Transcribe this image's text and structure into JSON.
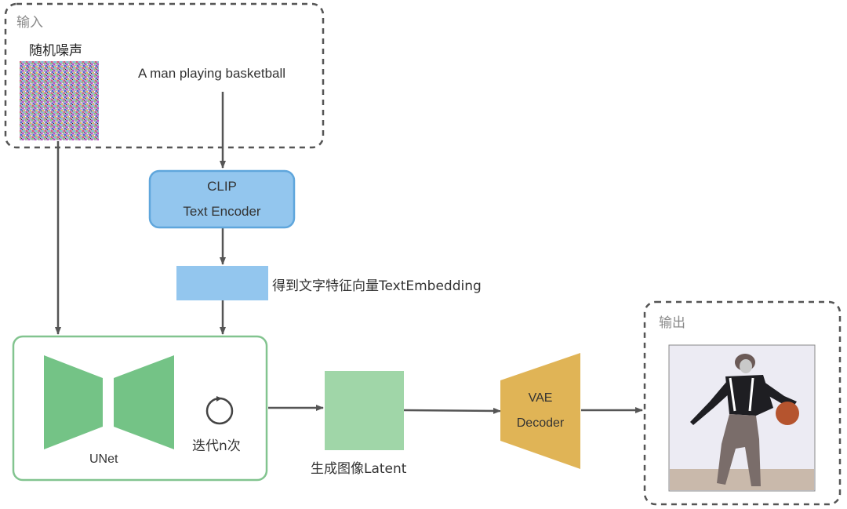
{
  "diagram": {
    "input_group": {
      "label": "输入"
    },
    "noise": {
      "label": "随机噪声"
    },
    "prompt": {
      "text": "A man playing basketball"
    },
    "clip": {
      "line1": "CLIP",
      "line2": "Text Encoder"
    },
    "embedding": {
      "label": "得到文字特征向量TextEmbedding"
    },
    "unet": {
      "label": "UNet",
      "iterate_label": "迭代n次"
    },
    "latent": {
      "label": "生成图像Latent"
    },
    "vae": {
      "line1": "VAE",
      "line2": "Decoder"
    },
    "output_group": {
      "label": "输出"
    },
    "colors": {
      "clip_fill": "#93c6ee",
      "clip_stroke": "#5fa6dc",
      "embedding_fill": "#93c6ee",
      "unet_fill": "#74c386",
      "unet_border": "#82c48f",
      "latent_fill": "#a0d6a8",
      "vae_fill": "#e0b456",
      "arrow": "#555555",
      "group_border": "#555555"
    }
  }
}
